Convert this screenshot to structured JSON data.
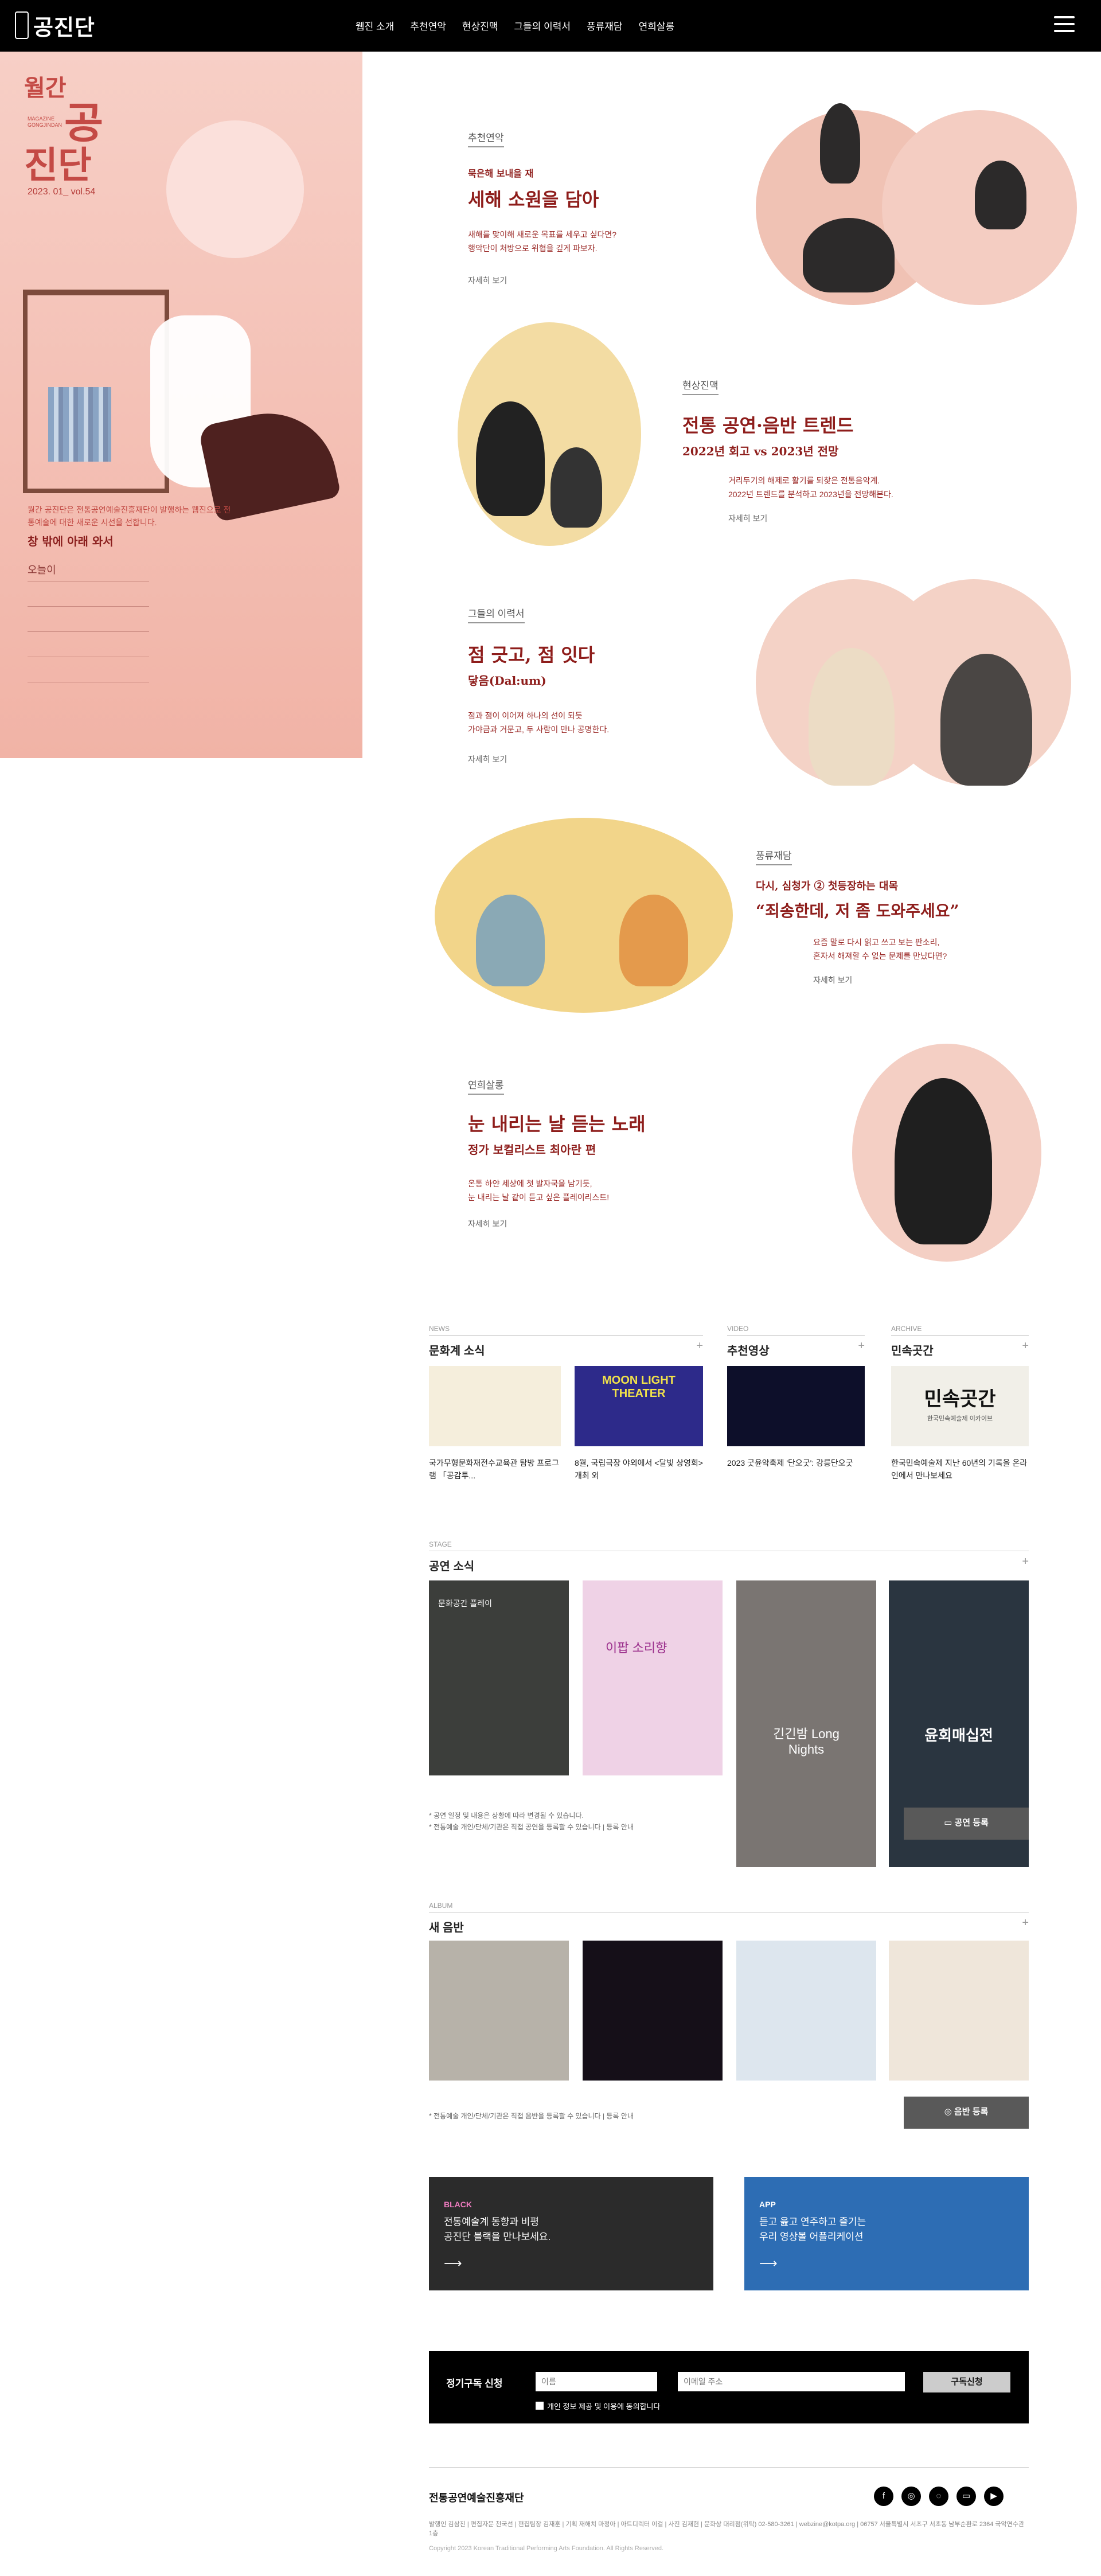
{
  "header": {
    "logo": "공진단",
    "nav": [
      "웹진 소개",
      "추천연악",
      "현상진맥",
      "그들의 이력서",
      "풍류재담",
      "연희살롱"
    ]
  },
  "side": {
    "title_line1": "월간",
    "title_line2": "공",
    "title_line3": "진단",
    "magazine": "MAGAZINE GONGJINDAN",
    "vol": "2023. 01_ vol.54",
    "desc": "월간 공진단은 전통공연예술진흥재단이 발행하는 웹진으로 전통예술에 대한 새로운 시선을 선합니다.",
    "sub": "창 밖에 아래 와서",
    "toc": [
      "오늘이",
      "",
      "",
      "",
      ""
    ]
  },
  "features": [
    {
      "cat": "추천연악",
      "kicker": "묵은해 보내을 재",
      "title": "세해 소원을 담아",
      "desc1": "새해를 맞이해 새로운 목표를 세우고 싶다면?",
      "desc2": "행악단이 처방으로 위협을 깊게 파보자.",
      "more": "자세히 보기"
    },
    {
      "cat": "현상진맥",
      "title": "전통 공연·음반 트렌드",
      "subtitle": "2022년 회고 vs 2023년 전망",
      "desc1": "거리두기의 해제로 활기를 되찾은 전통음악계.",
      "desc2": "2022년 트렌드를 분석하고 2023년을 전망해본다.",
      "more": "자세히 보기"
    },
    {
      "cat": "그들의 이력서",
      "title": "점 긋고, 점 잇다",
      "subtitle": "닿음(Dal:um)",
      "desc1": "점과 점이 이어져 하나의 선이 되듯",
      "desc2": "가야금과 거문고, 두 사람이 만나 공명한다.",
      "more": "자세히 보기"
    },
    {
      "cat": "풍류재담",
      "kicker": "다시, 심청가 ② 첫등장하는 대목",
      "title": "“죄송한데, 저 좀 도와주세요”",
      "desc1": "요즘 말로 다시 읽고 쓰고 보는 판소리,",
      "desc2": "혼자서 해져할 수 없는 문제를 만났다면?",
      "more": "자세히 보기"
    },
    {
      "cat": "연희살롱",
      "title": "눈 내리는 날 듣는 노래",
      "subtitle": "정가 보컬리스트 최아란 편",
      "desc1": "온통 하얀 세상에 첫 발자국을 남기듯,",
      "desc2": "눈 내리는 날 같이 듣고 싶은 플레이리스트!",
      "more": "자세히 보기"
    }
  ],
  "news": {
    "top": "NEWS",
    "title": "문화계 소식",
    "items": [
      {
        "caption": "국가무형문화재전수교육관 탐방 프로그램 「공감투..."
      },
      {
        "caption": "8월, 국립극장 야외에서 <달빛 상영회> 개최 외"
      }
    ],
    "img2_text": "MOON LIGHT THEATER"
  },
  "video": {
    "top": "VIDEO",
    "title": "추천영상",
    "caption": "2023 굿윤악축제 '단오굿': 강릉단오굿"
  },
  "archive": {
    "top": "ARCHIVE",
    "title": "민속곳간",
    "img_title": "민속곳간",
    "img_sub": "한국민속예술제 이카이브",
    "caption": "한국민속예술제 지난 60년의 기록을 온라인에서 만나보세요"
  },
  "stage": {
    "top": "STAGE",
    "title": "공연 소식",
    "posters": [
      "문화공간 플레이",
      "이팝 소리향",
      "긴긴밤 Long Nights",
      "윤회매십전"
    ],
    "notes": [
      "* 공연 일정 및 내용은 상황에 따라 변경될 수 있습니다.",
      "* 전통예술 개인/단체/기관은 직접 공연을 등록할 수 있습니다 | 등록 안내"
    ],
    "button": "공연 등록"
  },
  "album": {
    "top": "ALBUM",
    "title": "새 음반",
    "note": "* 전통예술 개인/단체/기관은 직접 음반을 등록할 수 있습니다 | 등록 안내",
    "button": "음반 등록"
  },
  "banners": [
    {
      "tag": "BLACK",
      "text1": "전통예술계 동향과 비평",
      "text2": "공진단 블랙을 만나보세요."
    },
    {
      "tag": "APP",
      "text1": "듣고 읊고 연주하고 즐기는",
      "text2": "우리 영상볼 어플리케이션"
    }
  ],
  "subscribe": {
    "label": "정기구독 신청",
    "name_ph": "이름",
    "email_ph": "이메일 주소",
    "button": "구독신청",
    "agree": "개인 정보 제공 및 이용에 동의합니다"
  },
  "footer": {
    "org": "전통공연예술진흥재단",
    "info": "발행인 김삼진 | 편집자문 천국선 | 편집팀장 김재훈 | 기획 재해치 마정아 | 아트디렉터 이걸 | 사진 김재현 | 문화상 대리점(위탁) 02-580-3261 | webzine@kotpa.org | 06757 서울특별시 서초구 서초동 남부순환로 2364 국악연수관 1층",
    "copy": "Copyright 2023 Korean Traditional Performing Arts Foundation. All Rights Reserved."
  }
}
